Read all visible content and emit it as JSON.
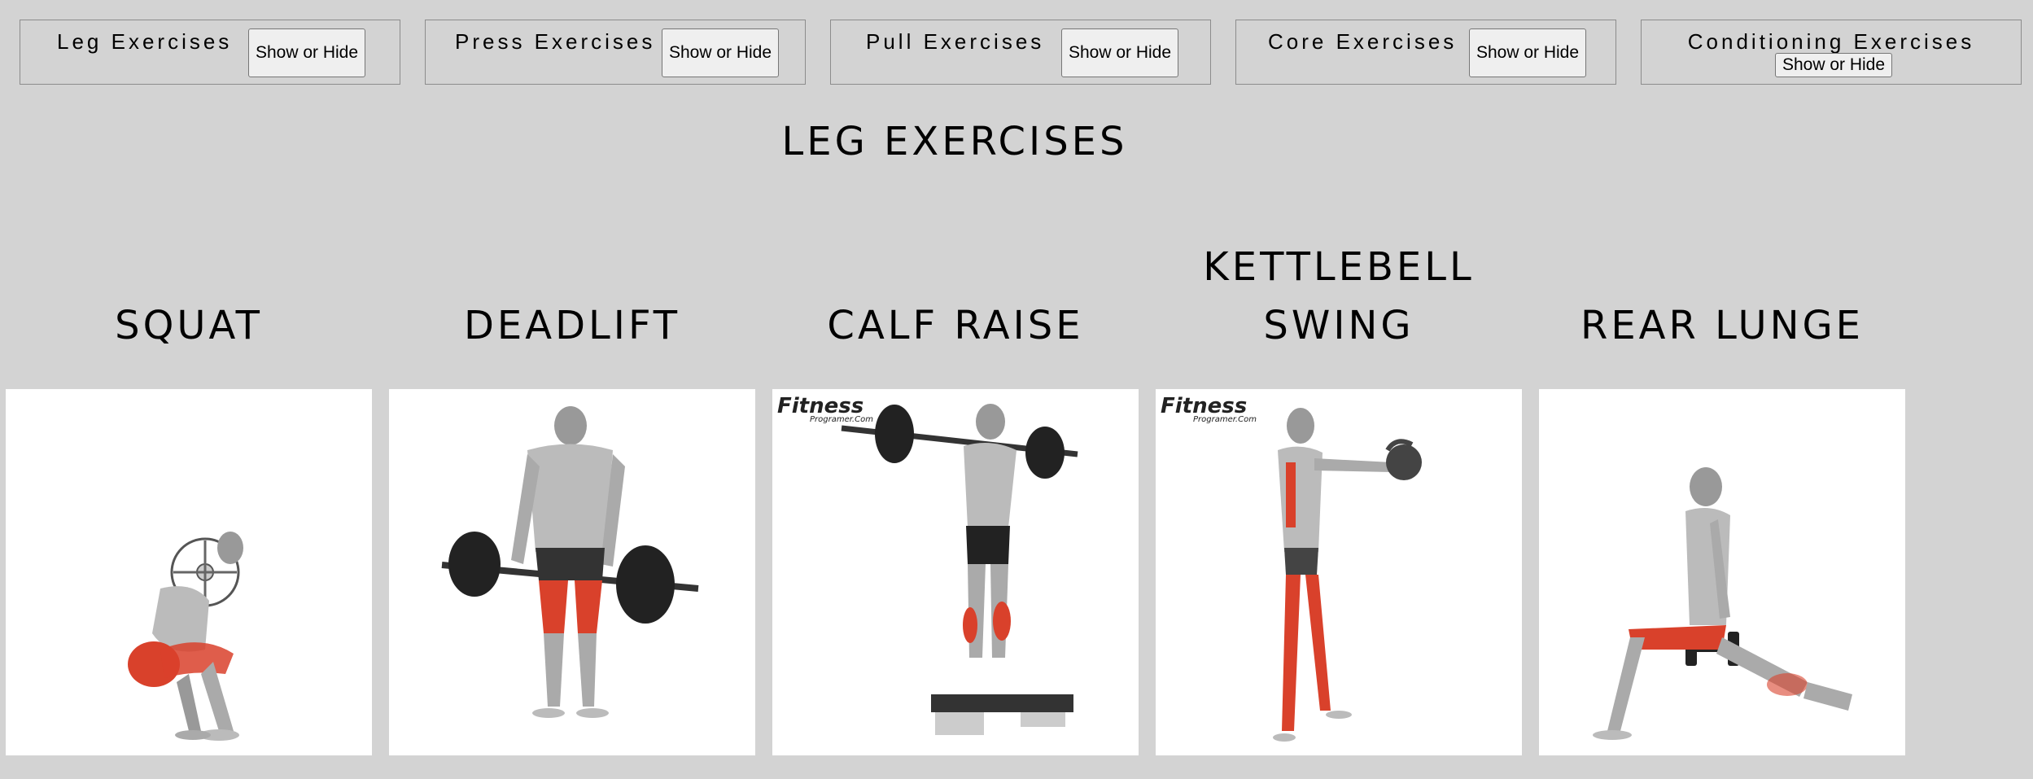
{
  "nav": [
    {
      "title": "Leg Exercises",
      "button": "Show or Hide"
    },
    {
      "title": "Press Exercises",
      "button": "Show or Hide"
    },
    {
      "title": "Pull Exercises",
      "button": "Show or Hide"
    },
    {
      "title": "Core Exercises",
      "button": "Show or Hide"
    },
    {
      "title": "Conditioning Exercises",
      "button": "Show or Hide"
    }
  ],
  "section_title": "LEG EXERCISES",
  "exercises": [
    {
      "name": "SQUAT"
    },
    {
      "name": "DEADLIFT"
    },
    {
      "name": "CALF RAISE",
      "watermark": "Fitness",
      "watermark_sub": "Programer.Com"
    },
    {
      "name_line1": "KETTLEBELL",
      "name_line2": "SWING",
      "watermark": "Fitness",
      "watermark_sub": "Programer.Com"
    },
    {
      "name": "REAR LUNGE"
    }
  ],
  "colors": {
    "background": "#d3d3d3",
    "muscle_highlight": "#d9412b",
    "card_bg": "#ffffff"
  }
}
